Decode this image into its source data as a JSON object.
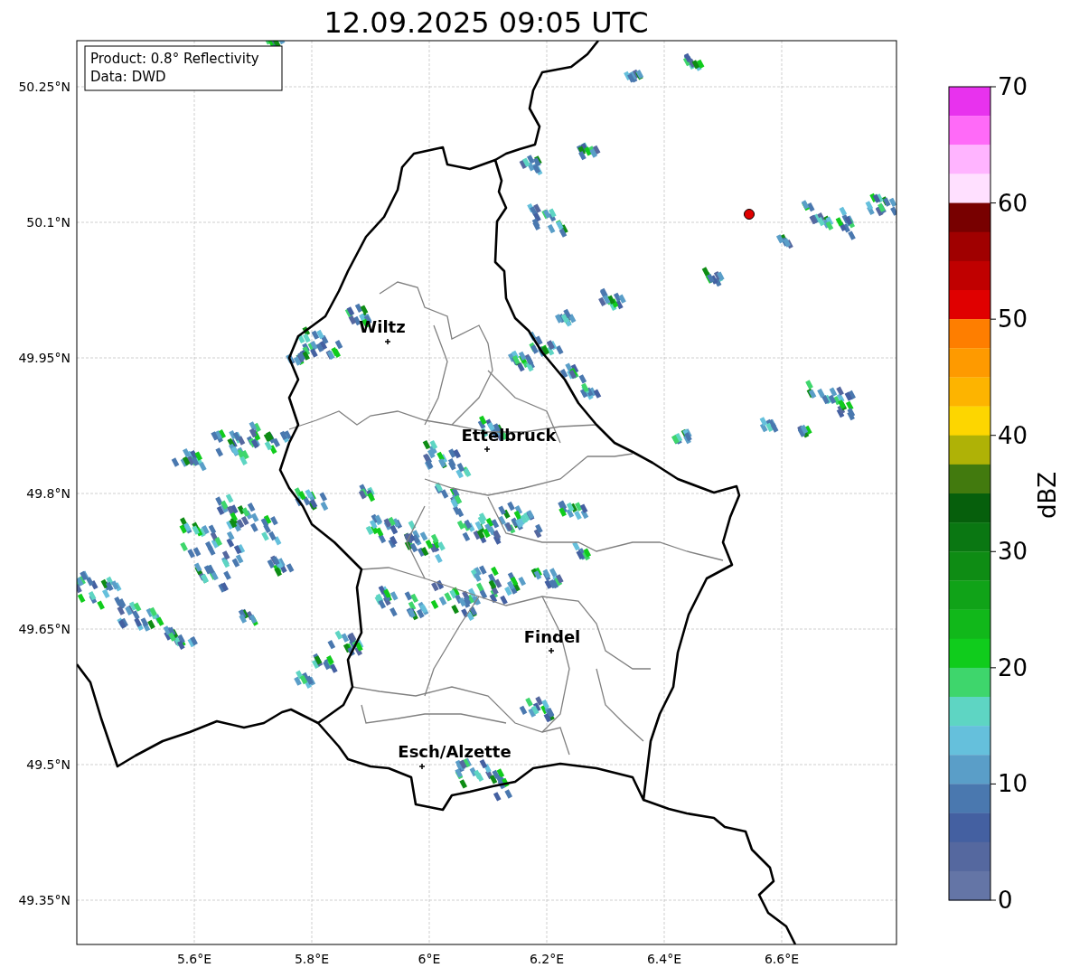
{
  "title": "12.09.2025 09:05 UTC",
  "info_box": [
    "Product: 0.8° Reflectivity",
    "Data: DWD"
  ],
  "lat_labels": [
    "50.25°N",
    "50.1°N",
    "49.95°N",
    "49.8°N",
    "49.65°N",
    "49.5°N",
    "49.35°N"
  ],
  "lon_labels": [
    "5.6°E",
    "5.8°E",
    "6°E",
    "6.2°E",
    "6.4°E",
    "6.6°E"
  ],
  "places": [
    {
      "name": "Wiltz"
    },
    {
      "name": "Ettelbruck"
    },
    {
      "name": "Findel"
    },
    {
      "name": "Esch/Alzette"
    }
  ],
  "colorbar": {
    "label": "dBZ",
    "ticks": [
      "70",
      "60",
      "50",
      "40",
      "30",
      "20",
      "10",
      "0"
    ],
    "bins": [
      {
        "color": "#e832ee"
      },
      {
        "color": "#ff6af8"
      },
      {
        "color": "#ffb4ff"
      },
      {
        "color": "#ffe0ff"
      },
      {
        "color": "#780000"
      },
      {
        "color": "#a00000"
      },
      {
        "color": "#c00000"
      },
      {
        "color": "#e00000"
      },
      {
        "color": "#fe7e00"
      },
      {
        "color": "#fe9a00"
      },
      {
        "color": "#fdb400"
      },
      {
        "color": "#fdd600"
      },
      {
        "color": "#afb206"
      },
      {
        "color": "#427a0e"
      },
      {
        "color": "#065f0c"
      },
      {
        "color": "#0a7712"
      },
      {
        "color": "#0e8c14"
      },
      {
        "color": "#10a318"
      },
      {
        "color": "#11b81a"
      },
      {
        "color": "#10cc1c"
      },
      {
        "color": "#3ed66c"
      },
      {
        "color": "#5ed5c3"
      },
      {
        "color": "#65c0dc"
      },
      {
        "color": "#5a9ec8"
      },
      {
        "color": "#4a78af"
      },
      {
        "color": "#4460a1"
      },
      {
        "color": "#55689f"
      },
      {
        "color": "#6475a6"
      }
    ]
  }
}
